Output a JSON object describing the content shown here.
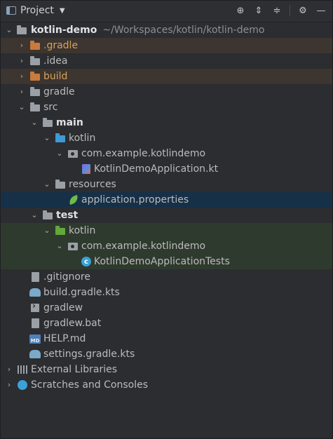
{
  "header": {
    "title": "Project"
  },
  "tree": {
    "root": {
      "label": "kotlin-demo",
      "path": "~/Workspaces/kotlin/kotlin-demo"
    },
    "items": {
      "gradle_hidden": ".gradle",
      "idea": ".idea",
      "build": "build",
      "gradle": "gradle",
      "src": "src",
      "main": "main",
      "main_kotlin": "kotlin",
      "main_pkg": "com.example.kotlindemo",
      "main_app": "KotlinDemoApplication.kt",
      "resources": "resources",
      "app_props": "application.properties",
      "test": "test",
      "test_kotlin": "kotlin",
      "test_pkg": "com.example.kotlindemo",
      "test_class": "KotlinDemoApplicationTests",
      "gitignore": ".gitignore",
      "build_gradle": "build.gradle.kts",
      "gradlew": "gradlew",
      "gradlew_bat": "gradlew.bat",
      "help": "HELP.md",
      "settings": "settings.gradle.kts",
      "ext_libs": "External Libraries",
      "scratches": "Scratches and Consoles"
    },
    "md_icon_text": "MD"
  },
  "colors": {
    "background": "#2b2d30",
    "selected_row": "#163048",
    "excluded_row": "#3c3530",
    "test_row": "#2f3a2f",
    "excluded_text": "#d6a25b"
  }
}
